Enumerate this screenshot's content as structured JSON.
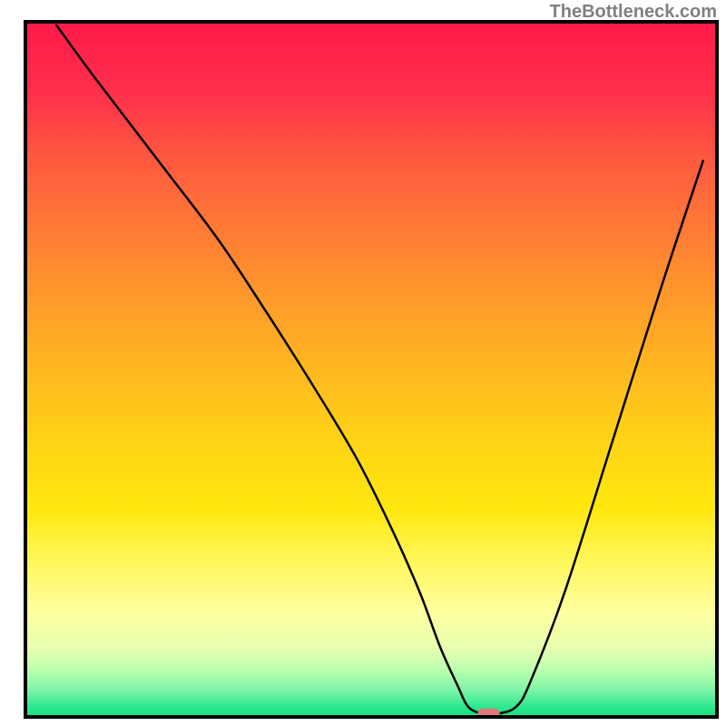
{
  "watermark": "TheBottleneck.com",
  "chart_data": {
    "type": "line",
    "title": "",
    "xlabel": "",
    "ylabel": "",
    "xlim": [
      0,
      100
    ],
    "ylim": [
      0,
      100
    ],
    "background": {
      "type": "vertical_gradient",
      "stops": [
        {
          "offset": 0.0,
          "color": "#ff1a4a"
        },
        {
          "offset": 0.1,
          "color": "#ff2f4a"
        },
        {
          "offset": 0.2,
          "color": "#ff5a3f"
        },
        {
          "offset": 0.3,
          "color": "#ff7a35"
        },
        {
          "offset": 0.4,
          "color": "#ff9a2a"
        },
        {
          "offset": 0.5,
          "color": "#ffb820"
        },
        {
          "offset": 0.6,
          "color": "#ffd216"
        },
        {
          "offset": 0.7,
          "color": "#ffe80e"
        },
        {
          "offset": 0.78,
          "color": "#fff85e"
        },
        {
          "offset": 0.85,
          "color": "#ffffa0"
        },
        {
          "offset": 0.9,
          "color": "#e8ffb0"
        },
        {
          "offset": 0.93,
          "color": "#c0ffb0"
        },
        {
          "offset": 0.96,
          "color": "#80f5a8"
        },
        {
          "offset": 0.985,
          "color": "#30e890"
        },
        {
          "offset": 1.0,
          "color": "#10e080"
        }
      ]
    },
    "series": [
      {
        "name": "bottleneck-curve",
        "color": "#000000",
        "x": [
          4.5,
          10,
          20,
          28,
          35,
          42,
          48,
          53,
          57,
          60,
          62.5,
          64,
          66,
          68.5,
          71,
          73,
          78,
          85,
          92,
          98
        ],
        "y": [
          99.5,
          92,
          79,
          68.5,
          58,
          47,
          37,
          27,
          18,
          10,
          4.5,
          1.5,
          0.5,
          0.5,
          1.5,
          5,
          18,
          40,
          62,
          80
        ]
      }
    ],
    "marker": {
      "name": "optimal-point",
      "x": 67,
      "y": 0.5,
      "color": "#e07878",
      "shape": "rounded-rect",
      "width": 3.2,
      "height": 1.4
    },
    "frame": {
      "color": "#000000",
      "width": 4
    }
  }
}
